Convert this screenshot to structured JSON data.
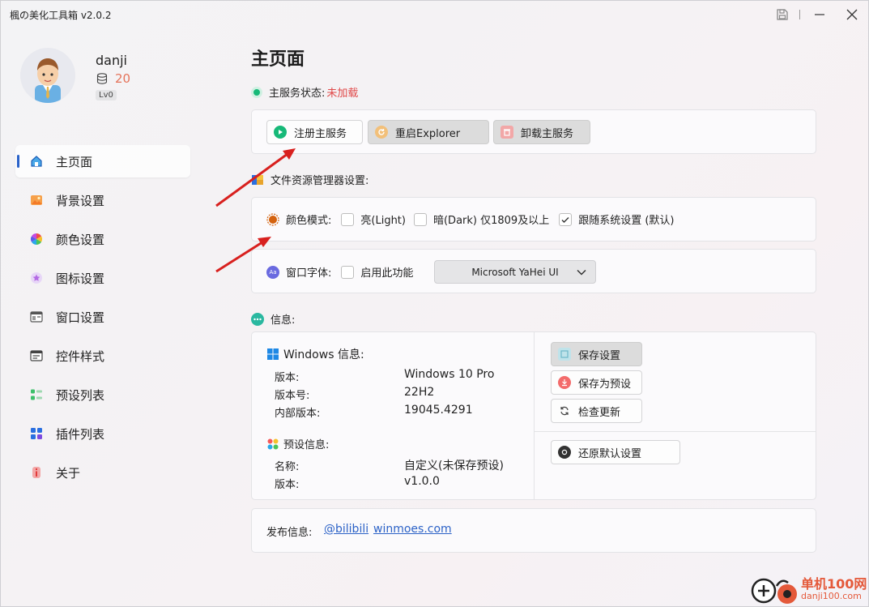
{
  "app": {
    "title": "楓の美化工具箱 v2.0.2"
  },
  "profile": {
    "username": "danji",
    "coins": "20",
    "level": "Lv0"
  },
  "sidebar": {
    "items": [
      {
        "label": "主页面",
        "icon": "home-icon"
      },
      {
        "label": "背景设置",
        "icon": "image-icon"
      },
      {
        "label": "颜色设置",
        "icon": "color-wheel-icon"
      },
      {
        "label": "图标设置",
        "icon": "star-icon"
      },
      {
        "label": "窗口设置",
        "icon": "window-icon"
      },
      {
        "label": "控件样式",
        "icon": "control-icon"
      },
      {
        "label": "预设列表",
        "icon": "list-icon"
      },
      {
        "label": "插件列表",
        "icon": "plugin-icon"
      },
      {
        "label": "关于",
        "icon": "info-icon"
      }
    ]
  },
  "main": {
    "title": "主页面",
    "status_label": "主服务状态:",
    "status_value": "未加载",
    "service_buttons": {
      "register": "注册主服务",
      "restart": "重启Explorer",
      "unload": "卸载主服务"
    },
    "explorer_section": "文件资源管理器设置:",
    "color_mode_label": "颜色模式:",
    "color_options": [
      "亮(Light)",
      "暗(Dark) 仅1809及以上",
      "跟随系统设置 (默认)"
    ],
    "font_label": "窗口字体:",
    "font_enable": "启用此功能",
    "font_select": "Microsoft YaHei UI",
    "info_section": "信息:",
    "windows_info": {
      "title": "Windows 信息:",
      "rows": [
        {
          "key": "版本:",
          "value": "Windows 10 Pro"
        },
        {
          "key": "版本号:",
          "value": "22H2"
        },
        {
          "key": "内部版本:",
          "value": "19045.4291"
        }
      ]
    },
    "preset_info": {
      "title": "预设信息:",
      "rows": [
        {
          "key": "名称:",
          "value": "自定义(未保存预设)"
        },
        {
          "key": "版本:",
          "value": "v1.0.0"
        }
      ]
    },
    "actions": {
      "save": "保存设置",
      "save_preset": "保存为预设",
      "check_update": "检查更新",
      "restore": "还原默认设置"
    },
    "release_label": "发布信息:",
    "links": [
      "@bilibili",
      "winmoes.com"
    ]
  },
  "watermark": {
    "line1": "单机100网",
    "line2": "danji100.com"
  },
  "colors": {
    "accent": "#2a62c9",
    "status_ok": "#17b978",
    "status_warn": "#e04848",
    "link": "#2c62c7",
    "annotation": "#d8201e"
  }
}
